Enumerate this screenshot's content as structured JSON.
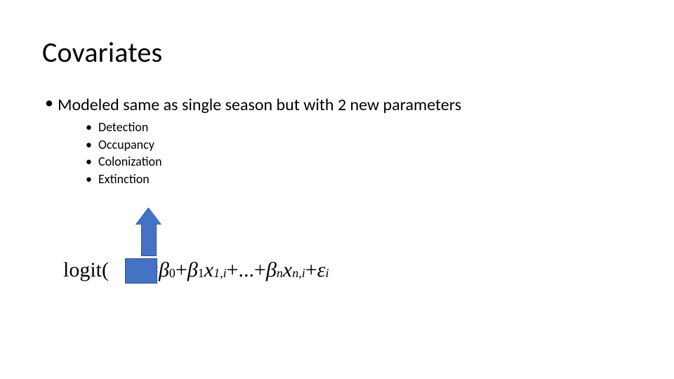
{
  "title": "Covariates",
  "bullet1": "Modeled same as single season but with 2 new parameters",
  "sub_items": {
    "a": "Detection",
    "b": "Occupancy",
    "c": "Colonization",
    "d": "Extinction"
  },
  "equation": {
    "func": "logit",
    "lpar": "(",
    "rpar": ")",
    "eq": " = ",
    "b0": "β",
    "b0_sub": "0",
    "plus1": " + ",
    "b1": "β",
    "b1_sub": "1",
    "x1": "x",
    "x1_sub": "1,i",
    "plus2": " + ",
    "dots": "...",
    "plus3": " + ",
    "bn": "β",
    "bn_sub": "n",
    "xn": "x",
    "xn_sub": "n,i",
    "plus4": " + ",
    "eps": "ε",
    "eps_sub": "i"
  }
}
